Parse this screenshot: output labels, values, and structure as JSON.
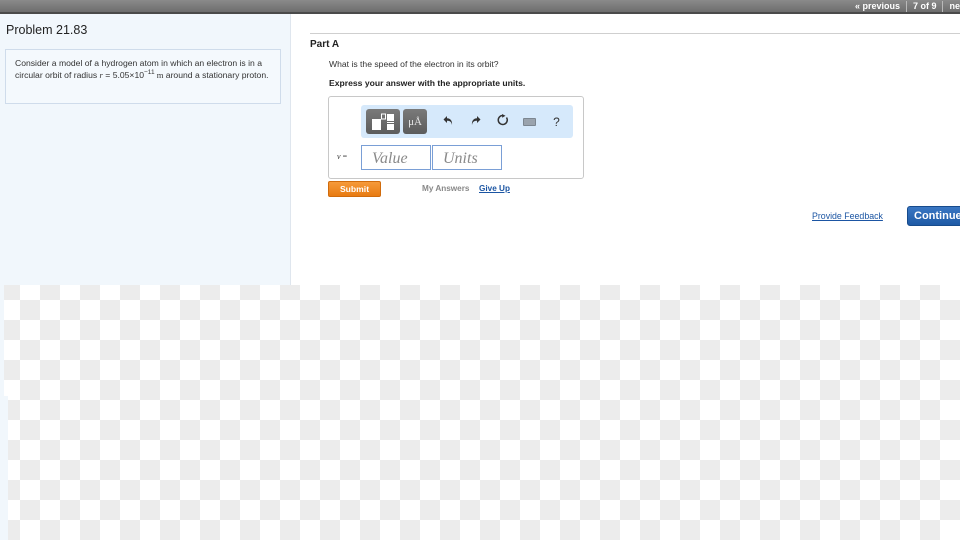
{
  "topbar": {
    "previous_label": "« previous",
    "position_label": "7 of 9",
    "next_label": "ne"
  },
  "problem": {
    "title": "Problem 21.83",
    "text_part1": "Consider a model of a hydrogen atom in which an electron is in a circular orbit of radius ",
    "variable": "r",
    "equals": " = 5.05×10",
    "exponent": "−11",
    "unit": " m",
    "text_part2": " around a stationary proton."
  },
  "part": {
    "title": "Part A",
    "question": "What is the speed of the electron in its orbit?",
    "instruction": "Express your answer with the appropriate units.",
    "toolbar": {
      "templates_icon": "templates-icon",
      "units_label": "μÅ",
      "undo_icon": "undo-icon",
      "redo_icon": "redo-icon",
      "reset_icon": "reset-icon",
      "keyboard_icon": "keyboard-icon",
      "help_label": "?"
    },
    "variable_label": "v",
    "equals_sign": " =",
    "value_placeholder": "Value",
    "units_placeholder": "Units",
    "value_input": "",
    "units_input": "",
    "submit_label": "Submit",
    "my_answers_label": "My Answers",
    "give_up_label": "Give Up"
  },
  "footer": {
    "feedback_label": "Provide Feedback",
    "continue_label": "Continue"
  },
  "colors": {
    "submit": "#e87b12",
    "continue": "#1e5aa5",
    "link": "#1b55a3",
    "toolbar_bg": "#d6e9fb",
    "panel_bg": "#f1f7fc"
  }
}
